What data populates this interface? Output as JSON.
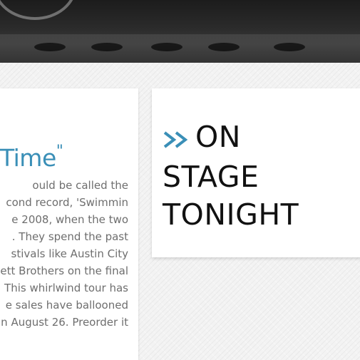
{
  "hero": {
    "image": "concert-stage-photo"
  },
  "article": {
    "title": "Time",
    "title_close_quote": "\"",
    "lines": [
      "ould be called the",
      "cond record, 'Swimmin",
      "e 2008, when the two",
      ". They spend the past",
      "stivals like Austin City",
      "ett Brothers on the final",
      ". This whirlwind tour has",
      "e sales have ballooned",
      "n August 26. Preorder it"
    ]
  },
  "sidebar": {
    "heading_lines": [
      "ON",
      "STAGE",
      "TONIGHT"
    ],
    "icon": "double-chevron-right-icon"
  },
  "colors": {
    "accent": "#3a8fb7",
    "heading": "#111111",
    "body_text": "#6e6e6e"
  }
}
